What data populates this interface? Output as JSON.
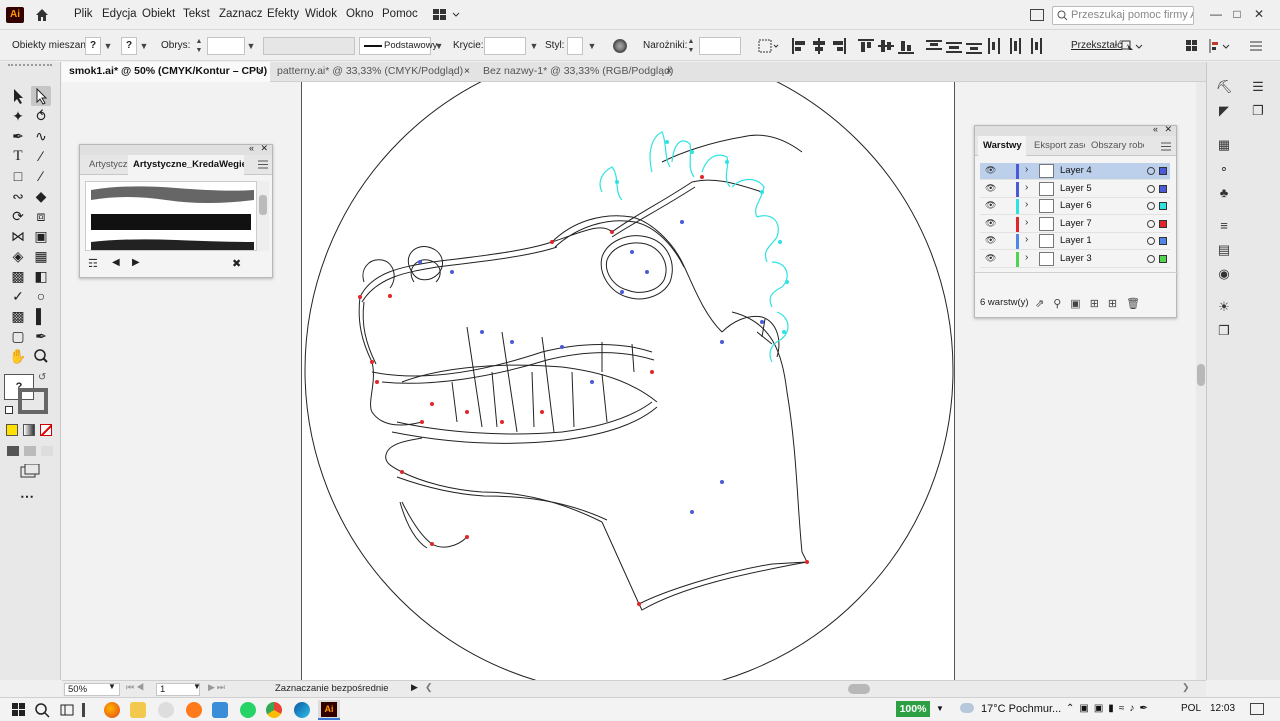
{
  "app": {
    "name": "Adobe Illustrator",
    "logo": "Ai"
  },
  "menu": [
    "Plik",
    "Edycja",
    "Obiekt",
    "Tekst",
    "Zaznacz",
    "Efekty",
    "Widok",
    "Okno",
    "Pomoc"
  ],
  "search": {
    "placeholder": "Przeszukaj pomoc firmy Adobe"
  },
  "control_bar": {
    "selection": "Obiekty mieszane",
    "fill": "?",
    "stroke": "?",
    "stroke_label": "Obrys:",
    "brush": "Podstawowy",
    "opacity_label": "Krycie:",
    "style_label": "Styl:",
    "corners_label": "Narożniki:",
    "transform_label": "Przekształć"
  },
  "tabs": [
    {
      "label": "smok1.ai* @ 50% (CMYK/Kontur – CPU)",
      "close": "×"
    },
    {
      "label": "patterny.ai* @ 33,33% (CMYK/Podgląd)",
      "close": "×"
    },
    {
      "label": "Bez nazwy-1* @ 33,33% (RGB/Podgląd)",
      "close": "×"
    }
  ],
  "brushes_panel": {
    "tabs": [
      "Artystyczne",
      "Artystyczne_KredaWegiel"
    ]
  },
  "layers_panel": {
    "tabs": [
      "Warstwy",
      "Eksport zasobów",
      "Obszary robocze"
    ],
    "layers": [
      {
        "name": "Layer 4",
        "color": "#4a5bd8",
        "selected": true
      },
      {
        "name": "Layer 5",
        "color": "#4a5bd8",
        "selected": false
      },
      {
        "name": "Layer 6",
        "color": "#2fe2e2",
        "selected": false
      },
      {
        "name": "Layer 7",
        "color": "#e0262a",
        "selected": false
      },
      {
        "name": "Layer 1",
        "color": "#4f86e8",
        "selected": false
      },
      {
        "name": "Layer 3",
        "color": "#52d352",
        "selected": false
      }
    ],
    "count": "6 warstw(y)"
  },
  "status": {
    "zoom": "50%",
    "artboard": "1",
    "tool": "Zaznaczanie bezpośrednie"
  },
  "taskbar": {
    "zoom_badge": "100%",
    "weather": "17°C  Pochmur...",
    "language": "POL",
    "time": "12:03"
  },
  "colors": {
    "accent": "#bcd0ec",
    "anchor_red": "#e0262a",
    "anchor_blue": "#4a5bd8",
    "anchor_cyan": "#2fe2e2"
  }
}
